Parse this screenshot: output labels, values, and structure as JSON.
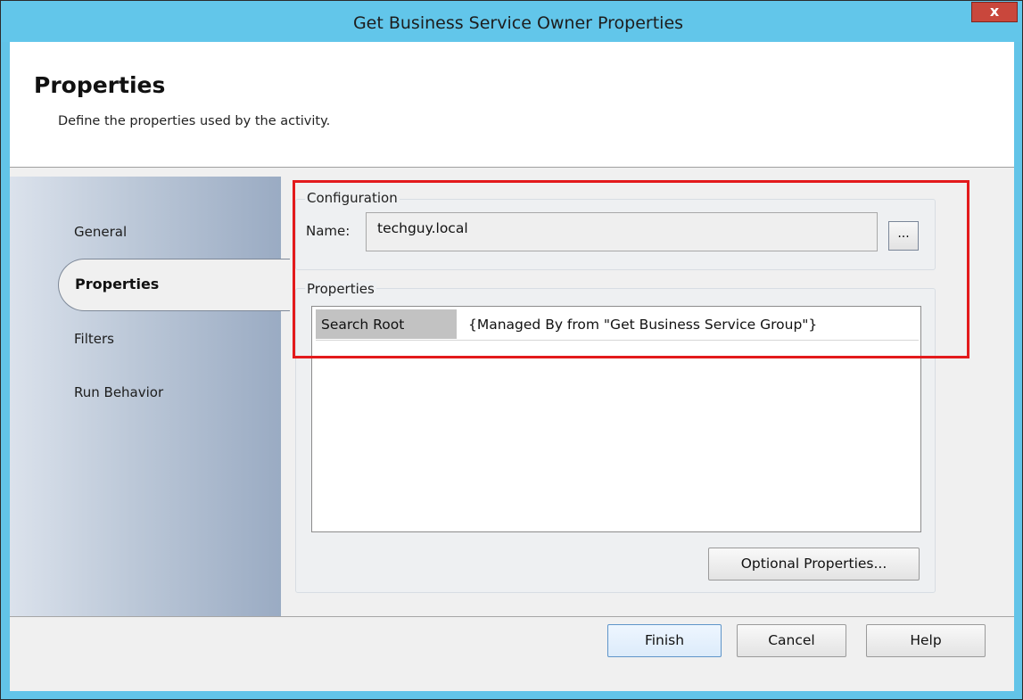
{
  "window": {
    "title": "Get Business Service Owner Properties",
    "close_label": "x"
  },
  "header": {
    "title": "Properties",
    "description": "Define the properties used by the activity."
  },
  "sidebar": {
    "items": [
      {
        "label": "General"
      },
      {
        "label": "Properties",
        "selected": true
      },
      {
        "label": "Filters"
      },
      {
        "label": "Run Behavior"
      }
    ]
  },
  "configuration": {
    "group_label": "Configuration",
    "name_label": "Name:",
    "name_value": "techguy.local",
    "browse_label": "..."
  },
  "properties": {
    "group_label": "Properties",
    "rows": [
      {
        "key": "Search Root",
        "value": "{Managed By from \"Get Business Service Group\"}"
      }
    ],
    "optional_button": "Optional Properties..."
  },
  "footer": {
    "finish": "Finish",
    "cancel": "Cancel",
    "help": "Help"
  },
  "colors": {
    "titlebar": "#62c6ea",
    "highlight": "#e31a1c",
    "close": "#c9473c"
  }
}
